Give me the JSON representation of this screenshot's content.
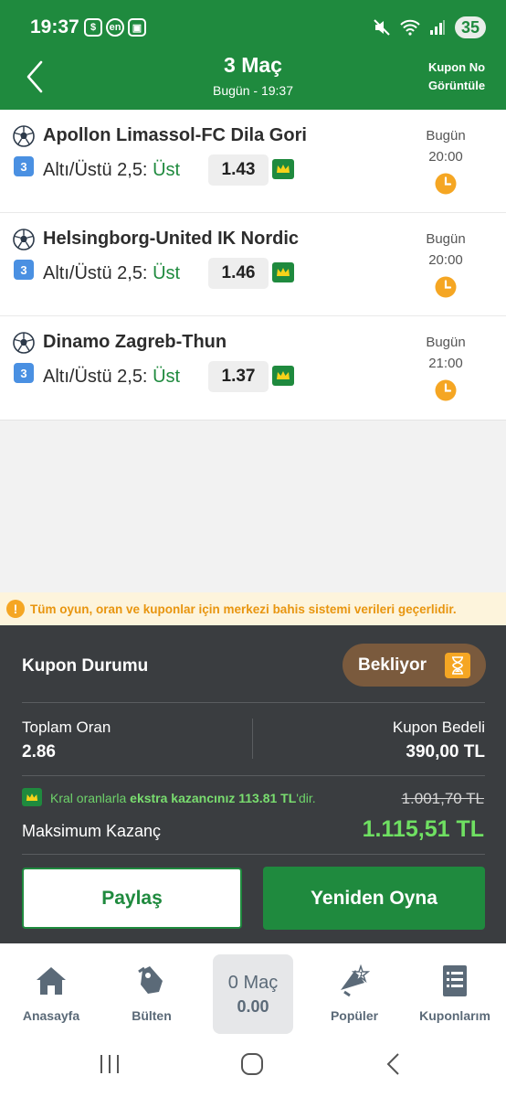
{
  "status_bar": {
    "time": "19:37",
    "icons_left": [
      "dollar-icon",
      "en-icon",
      "screenshot-icon"
    ],
    "icons_right": [
      "mute-icon",
      "wifi-icon",
      "signal-icon"
    ],
    "battery": "35",
    "en_label": "en"
  },
  "header": {
    "title": "3 Maç",
    "subtitle": "Bugün - 19:37",
    "kupon_no_label": "Kupon No Görüntüle",
    "color": "#1f8a3e"
  },
  "matches": [
    {
      "name": "Apollon Limassol-FC Dila Gori",
      "badge": "3",
      "market": "Altı/Üstü 2,5:",
      "selection": "Üst",
      "odd": "1.43",
      "day": "Bugün",
      "hour": "20:00"
    },
    {
      "name": "Helsingborg-United IK Nordic",
      "badge": "3",
      "market": "Altı/Üstü 2,5:",
      "selection": "Üst",
      "odd": "1.46",
      "day": "Bugün",
      "hour": "20:00"
    },
    {
      "name": "Dinamo Zagreb-Thun",
      "badge": "3",
      "market": "Altı/Üstü 2,5:",
      "selection": "Üst",
      "odd": "1.37",
      "day": "Bugün",
      "hour": "21:00"
    }
  ],
  "banner": {
    "text": "Tüm oyun, oran ve kuponlar için merkezi bahis sistemi verileri geçerlidir."
  },
  "summary": {
    "status_label": "Kupon Durumu",
    "status_value": "Bekliyor",
    "total_odds_label": "Toplam Oran",
    "total_odds": "2.86",
    "stake_label": "Kupon Bedeli",
    "stake": "390,00 TL",
    "kral_prefix": "Kral oranlarla",
    "kral_bold": "ekstra kazancınız 113.81 TL",
    "kral_suffix": "'dir.",
    "old_max": "1.001,70 TL",
    "max_label": "Maksimum Kazanç",
    "max_value": "1.115,51 TL",
    "share_label": "Paylaş",
    "replay_label": "Yeniden Oyna"
  },
  "bottom_nav": {
    "items": [
      {
        "label": "Anasayfa",
        "icon": "home-icon"
      },
      {
        "label": "Bülten",
        "icon": "bulletin-icon"
      },
      {
        "label": "Popüler",
        "icon": "popular-icon"
      },
      {
        "label": "Kuponlarım",
        "icon": "coupons-icon"
      }
    ],
    "cart": {
      "count": "0 Maç",
      "total": "0.00"
    }
  },
  "colors": {
    "brand_green": "#1f8a3e",
    "panel_dark": "#3a3d40",
    "warning_orange": "#f5a623",
    "max_green": "#6fe062"
  }
}
